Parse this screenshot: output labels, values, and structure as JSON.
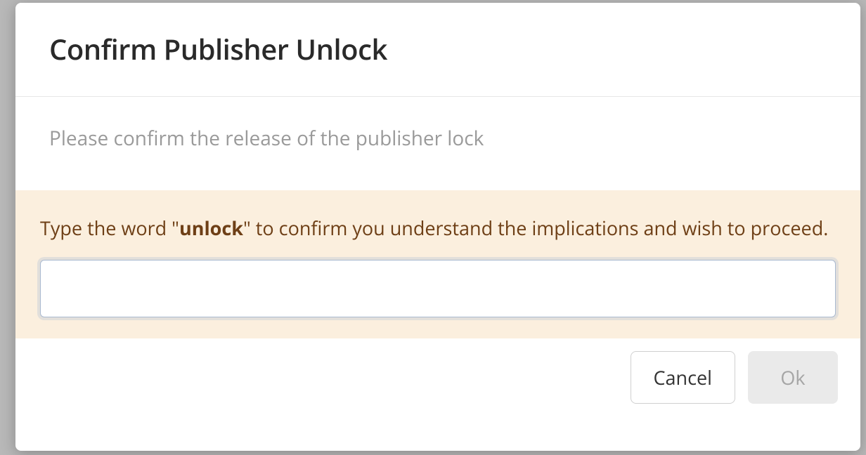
{
  "modal": {
    "title": "Confirm Publisher Unlock",
    "description": "Please confirm the release of the publisher lock",
    "warning_prefix": "Type the word \"",
    "warning_keyword": "unlock",
    "warning_suffix": "\" to confirm you understand the implications and wish to proceed.",
    "input_value": ""
  },
  "buttons": {
    "cancel": "Cancel",
    "ok": "Ok"
  }
}
